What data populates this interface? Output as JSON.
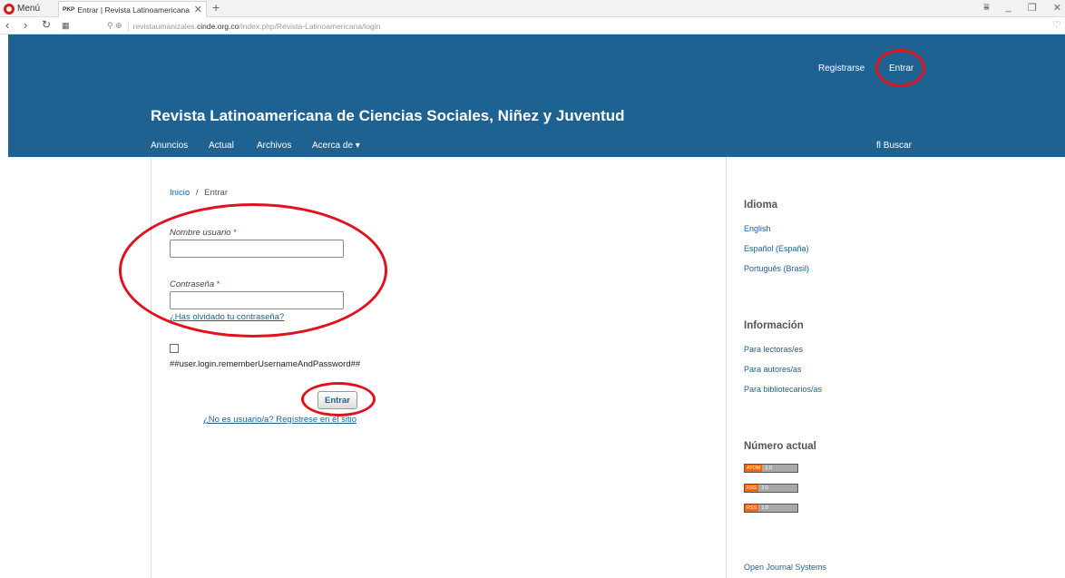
{
  "browser": {
    "menu_label": "Menú",
    "tab": {
      "favicon": "PKP",
      "title": "Entrar | Revista Latinoamericana",
      "close": "✕"
    },
    "new_tab": "+",
    "url": {
      "prefix": "revistaumanizales.",
      "domain": "cinde.org.co",
      "path": "/index.php/Revista-Latinoamericana/login"
    },
    "icons": [
      "opera-logo",
      "back-icon",
      "forward-icon",
      "reload-icon",
      "speed-dial-icon",
      "shield-icon",
      "globe-icon",
      "heart-icon",
      "filter-icon",
      "minimize-icon",
      "restore-icon",
      "close-icon"
    ]
  },
  "header": {
    "user_nav": {
      "register": "Registrarse",
      "login": "Entrar"
    },
    "title": "Revista Latinoamericana de Ciencias Sociales, Niñez y Juventud",
    "nav": [
      {
        "label": "Anuncios"
      },
      {
        "label": "Actual"
      },
      {
        "label": "Archivos"
      },
      {
        "label": "Acerca de ▾"
      }
    ],
    "search": "fl Buscar",
    "color": "#1e6292"
  },
  "breadcrumb": {
    "home": "Inicio",
    "separator": "/",
    "current": "Entrar"
  },
  "form": {
    "username_label": "Nombre usuario",
    "password_label": "Contraseña",
    "required_mark": "*",
    "forgot": "¿Has olvidado tu contraseña?",
    "remember_label": "##user.login.rememberUsernameAndPassword##",
    "submit": "Entrar",
    "register": "¿No es usuario/a? Regístrese en el sitio"
  },
  "sidebar": {
    "language": {
      "title": "Idioma",
      "items": [
        "English",
        "Español (España)",
        "Português (Brasil)"
      ]
    },
    "info": {
      "title": "Información",
      "items": [
        "Para lectoras/es",
        "Para autores/as",
        "Para bibliotecarios/as"
      ]
    },
    "current": {
      "title": "Número actual",
      "feeds": [
        {
          "left": "ATOM",
          "right": "1.0"
        },
        {
          "left": "RSS",
          "right": "2.0"
        },
        {
          "left": "RSS",
          "right": "1.0"
        }
      ]
    },
    "footer_link": "Open Journal Systems"
  },
  "annotation_color": "#e0121b"
}
